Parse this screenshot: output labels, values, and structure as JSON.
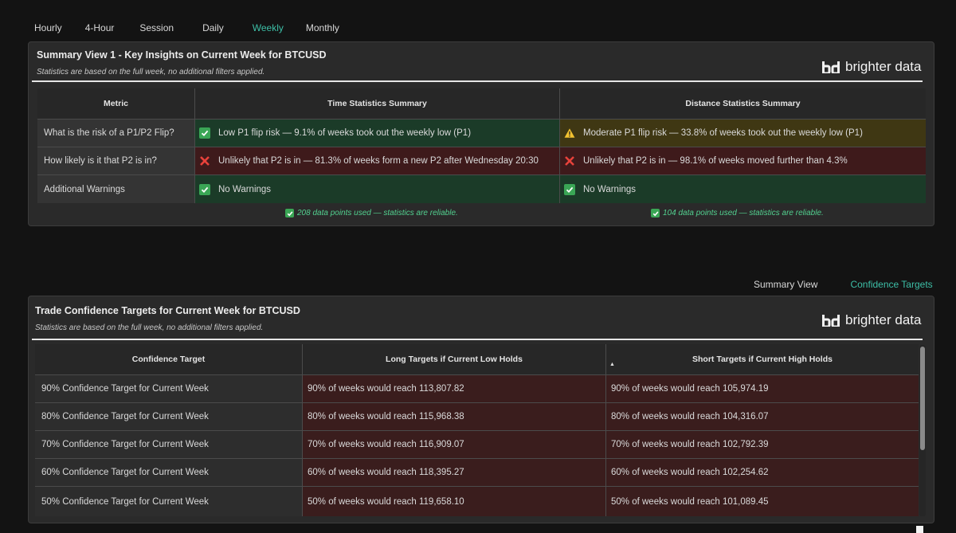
{
  "tabs": [
    "Hourly",
    "4-Hour",
    "Session",
    "Daily",
    "Weekly",
    "Monthly"
  ],
  "active_tab": "Weekly",
  "brand": {
    "name": "brighter data"
  },
  "summary": {
    "title": "Summary View 1 - Key Insights on Current Week for BTCUSD",
    "subtitle": "Statistics are based on the full week, no additional filters applied.",
    "headers": [
      "Metric",
      "Time Statistics Summary",
      "Distance Statistics Summary"
    ],
    "rows": [
      {
        "metric": "What is the risk of a P1/P2 Flip?",
        "time": {
          "text": "Low P1 flip risk — 9.1% of weeks took out the weekly low (P1)",
          "status": "ok"
        },
        "distance": {
          "text": "Moderate P1 flip risk — 33.8% of weeks took out the weekly low (P1)",
          "status": "warn"
        }
      },
      {
        "metric": "How likely is it that P2 is in?",
        "time": {
          "text": "Unlikely that P2 is in — 81.3% of weeks form a new P2 after Wednesday 20:30",
          "status": "bad"
        },
        "distance": {
          "text": "Unlikely that P2 is in — 98.1% of weeks moved further than 4.3%",
          "status": "bad"
        }
      },
      {
        "metric": "Additional Warnings",
        "time": {
          "text": "No Warnings",
          "status": "ok"
        },
        "distance": {
          "text": "No Warnings",
          "status": "ok"
        }
      }
    ],
    "notes": {
      "time": "208 data points used — statistics are reliable.",
      "distance": "104 data points used — statistics are reliable."
    }
  },
  "view_tabs": [
    "Summary View",
    "Confidence Targets"
  ],
  "active_view": "Confidence Targets",
  "targets": {
    "title": "Trade Confidence Targets for Current Week for BTCUSD",
    "subtitle": "Statistics are based on the full week, no additional filters applied.",
    "headers": [
      "Confidence Target",
      "Long Targets if Current Low Holds",
      "Short Targets if Current High Holds"
    ],
    "rows": [
      {
        "label": "90% Confidence Target for Current Week",
        "long": "90% of weeks would reach 113,807.82",
        "short": "90% of weeks would reach 105,974.19"
      },
      {
        "label": "80% Confidence Target for Current Week",
        "long": "80% of weeks would reach 115,968.38",
        "short": "80% of weeks would reach 104,316.07"
      },
      {
        "label": "70% Confidence Target for Current Week",
        "long": "70% of weeks would reach 116,909.07",
        "short": "70% of weeks would reach 102,792.39"
      },
      {
        "label": "60% Confidence Target for Current Week",
        "long": "60% of weeks would reach 118,395.27",
        "short": "60% of weeks would reach 102,254.62"
      },
      {
        "label": "50% Confidence Target for Current Week",
        "long": "50% of weeks would reach 119,658.10",
        "short": "50% of weeks would reach 101,089.45"
      }
    ]
  },
  "colors": {
    "accent": "#3dbfa7",
    "ok": "#1b3b28",
    "bad": "#3e1a1b",
    "warn": "#3f3713",
    "note": "#52d08f"
  }
}
